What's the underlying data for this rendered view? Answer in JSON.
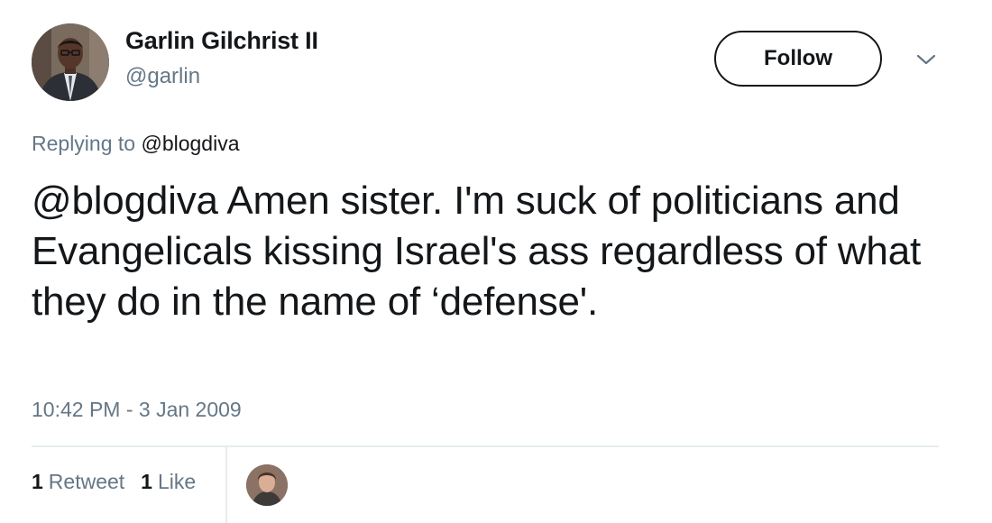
{
  "author": {
    "name": "Garlin Gilchrist II",
    "handle": "@garlin"
  },
  "header": {
    "follow_label": "Follow",
    "menu_icon": "chevron-down-icon"
  },
  "reply": {
    "prefix": "Replying to",
    "mention": "@blogdiva"
  },
  "tweet": {
    "mention": "@blogdiva",
    "text": " Amen sister. I'm suck of politicians and Evangelicals kissing Israel's ass regardless of what they do in the name of ‘defense'.",
    "timestamp": "10:42 PM - 3 Jan 2009"
  },
  "stats": {
    "retweet_count": "1",
    "retweet_label": "Retweet",
    "like_count": "1",
    "like_label": "Like"
  },
  "colors": {
    "text": "#14171a",
    "secondary": "#657786",
    "divider": "#e6ecf0"
  }
}
